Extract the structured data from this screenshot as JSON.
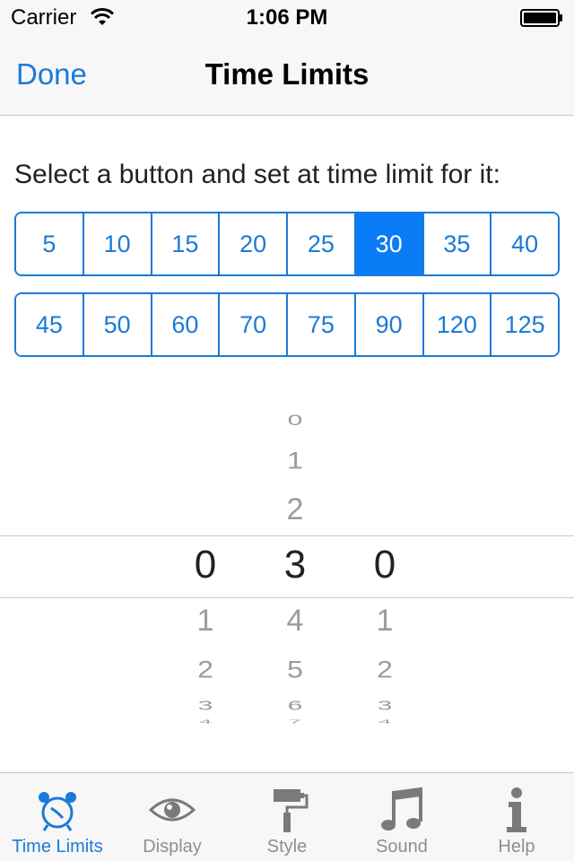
{
  "status_bar": {
    "carrier": "Carrier",
    "time": "1:06 PM"
  },
  "nav": {
    "done_label": "Done",
    "title": "Time Limits"
  },
  "instruction": "Select a button and set at time limit for it:",
  "presets": {
    "row1": [
      "5",
      "10",
      "15",
      "20",
      "25",
      "30",
      "35",
      "40"
    ],
    "row2": [
      "45",
      "50",
      "60",
      "70",
      "75",
      "90",
      "120",
      "125"
    ],
    "selected": "30"
  },
  "picker": {
    "columns": [
      {
        "selected": "0",
        "above": [],
        "below": [
          "1",
          "2",
          "3",
          "4"
        ]
      },
      {
        "selected": "3",
        "above": [
          "0",
          "1",
          "2"
        ],
        "below": [
          "4",
          "5",
          "6",
          "7"
        ]
      },
      {
        "selected": "0",
        "above": [],
        "below": [
          "1",
          "2",
          "3",
          "4"
        ]
      }
    ]
  },
  "tabs": [
    {
      "label": "Time Limits",
      "icon": "alarm-clock-icon",
      "active": true
    },
    {
      "label": "Display",
      "icon": "eye-icon",
      "active": false
    },
    {
      "label": "Style",
      "icon": "paint-roller-icon",
      "active": false
    },
    {
      "label": "Sound",
      "icon": "music-note-icon",
      "active": false
    },
    {
      "label": "Help",
      "icon": "info-icon",
      "active": false
    }
  ],
  "colors": {
    "accent": "#1a7ad8",
    "selected_fill": "#0a7cf6",
    "inactive": "#8e8e93"
  }
}
